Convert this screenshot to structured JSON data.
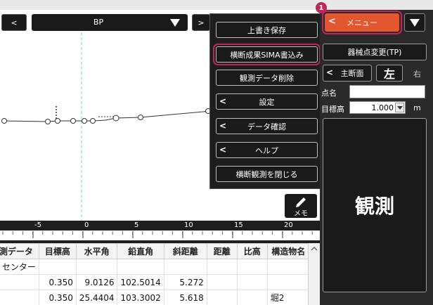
{
  "toolbar": {
    "prev_glyph": "<",
    "next_glyph": ">",
    "station_value": "BP"
  },
  "menu": {
    "button_label": "メニュー",
    "callout_number": "1",
    "items": [
      {
        "label": "上書き保存",
        "chevron": false
      },
      {
        "label": "横断成果SIMA書込み",
        "chevron": false,
        "highlight": true
      },
      {
        "label": "観測データ削除",
        "chevron": false
      },
      {
        "label": "設定",
        "chevron": true
      },
      {
        "label": "データ確認",
        "chevron": true
      },
      {
        "label": "ヘルプ",
        "chevron": true
      },
      {
        "label": "横断観測を閉じる",
        "chevron": false
      }
    ]
  },
  "right_panel": {
    "change_instrument_label": "器械点変更(TP)",
    "main_section_label": "主断面",
    "left_label": "左",
    "right_label": "右",
    "point_name_label": "点名",
    "point_name_value": "",
    "target_height_label": "目標高",
    "target_height_value": "1.000",
    "target_height_unit": "m",
    "observe_label": "観測"
  },
  "canvas": {
    "memo_label": "メモ"
  },
  "ruler": {
    "ticks": [
      "-5",
      "0",
      "5",
      "10",
      "15",
      "20"
    ]
  },
  "table": {
    "headers": [
      "測データ",
      "目標高",
      "水平角",
      "鉛直角",
      "斜距離",
      "距離",
      "比高",
      "構造物名"
    ],
    "rows": [
      [
        ": センター",
        "",
        "",
        "",
        "",
        "",
        "",
        ""
      ],
      [
        "",
        "0.350",
        "9.0126",
        "102.5014",
        "5.272",
        "",
        "",
        ""
      ],
      [
        "",
        "0.350",
        "25.4404",
        "103.3002",
        "5.618",
        "",
        "",
        "堀2"
      ]
    ]
  },
  "colors": {
    "accent": "#e4572e",
    "callout": "#c0255b",
    "panel_bg": "#2a2a2a",
    "guide_line": "#66dada"
  }
}
